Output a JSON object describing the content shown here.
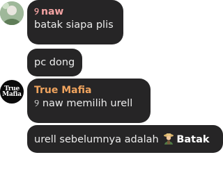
{
  "messages": [
    {
      "author": "naw",
      "author_glyph": "୨",
      "text": "batak siapa plis"
    },
    {
      "text": "pc dong"
    },
    {
      "author": "True Mafia",
      "text": "୨ naw memilih urell"
    },
    {
      "text_prefix": "urell sebelumnya adalah",
      "role": "Batak",
      "role_icon": "farmer-emoji-icon"
    }
  ],
  "avatars": {
    "naw": {
      "icon": "avatar-photo"
    },
    "mafia": {
      "logo_line1": "True",
      "logo_line2": "Mafia"
    }
  },
  "colors": {
    "bubble": "#262526",
    "text": "#ececec",
    "author_naw": "#f4a3a3",
    "author_mafia": "#f0a45e"
  }
}
